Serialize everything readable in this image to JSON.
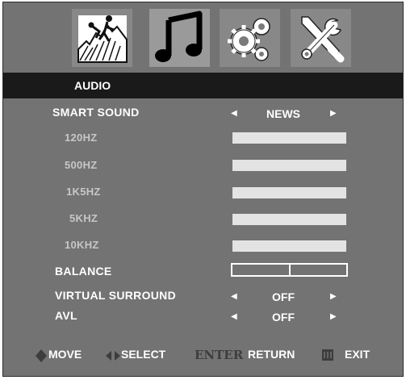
{
  "tabs": [
    {
      "name": "picture",
      "icon": "mountain-climber-icon"
    },
    {
      "name": "audio",
      "icon": "music-note-icon",
      "selected": true
    },
    {
      "name": "settings",
      "icon": "gears-icon"
    },
    {
      "name": "tools",
      "icon": "wrench-screwdriver-icon"
    }
  ],
  "header": {
    "title": "AUDIO"
  },
  "menu": {
    "smart_sound": {
      "label": "SMART SOUND",
      "value": "NEWS"
    },
    "eq": [
      {
        "label": "120HZ"
      },
      {
        "label": "500HZ"
      },
      {
        "label": "1K5HZ"
      },
      {
        "label": "5KHZ"
      },
      {
        "label": "10KHZ"
      }
    ],
    "balance": {
      "label": "BALANCE",
      "level": 0.5
    },
    "virtual_surround": {
      "label": "VIRTUAL SURROUND",
      "value": "OFF"
    },
    "avl": {
      "label": "AVL",
      "value": "OFF"
    }
  },
  "footer": {
    "move": "MOVE",
    "select": "SELECT",
    "enter": "ENTER",
    "return": "RETURN",
    "exit": "EXIT"
  },
  "colors": {
    "panel": "#737373",
    "header": "#1a1a1a",
    "bar": "#e3e3e3",
    "text": "#ffffff"
  }
}
